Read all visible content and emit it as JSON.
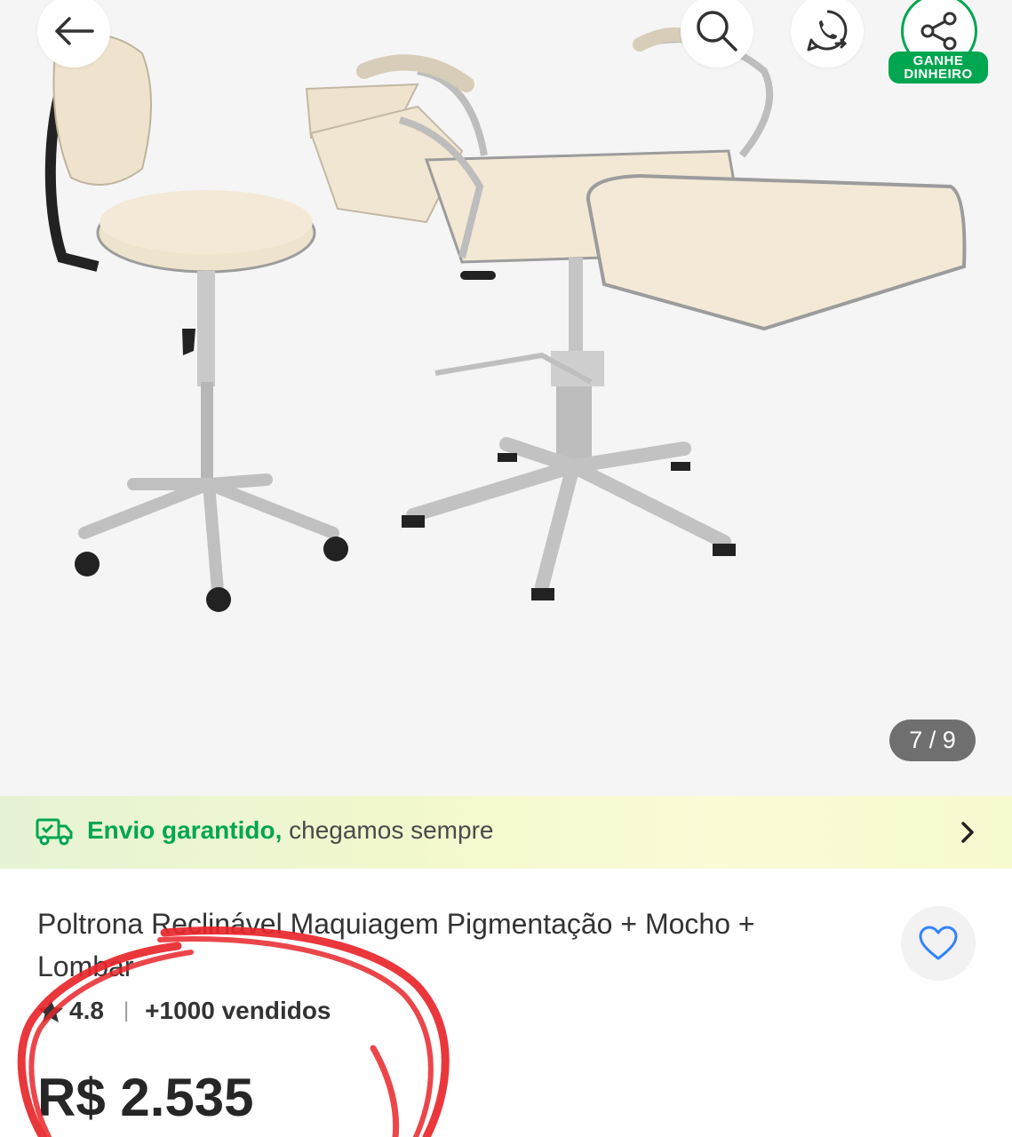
{
  "gallery": {
    "image_alt": "Poltrona Reclinável Maquiagem Pigmentação + Mocho + Lombar",
    "counter": "7 / 9",
    "icons": {
      "back": "arrow-left-icon",
      "search": "search-icon",
      "whatsapp": "whatsapp-icon",
      "share": "share-icon"
    },
    "share_label_line1": "GANHE",
    "share_label_line2": "DINHEIRO"
  },
  "shipping": {
    "icon": "truck-icon",
    "highlight": "Envio garantido,",
    "rest": " chegamos sempre"
  },
  "product": {
    "title": "Poltrona Reclinável Maquiagem Pigmentação + Mocho + Lombar",
    "rating": "4.8",
    "separator": "|",
    "sold": "+1000 vendidos",
    "price": "R$ 2.535"
  },
  "colors": {
    "accent_green": "#00a650",
    "favorite_blue": "#3483fa",
    "annotation_red": "#e8262a"
  }
}
